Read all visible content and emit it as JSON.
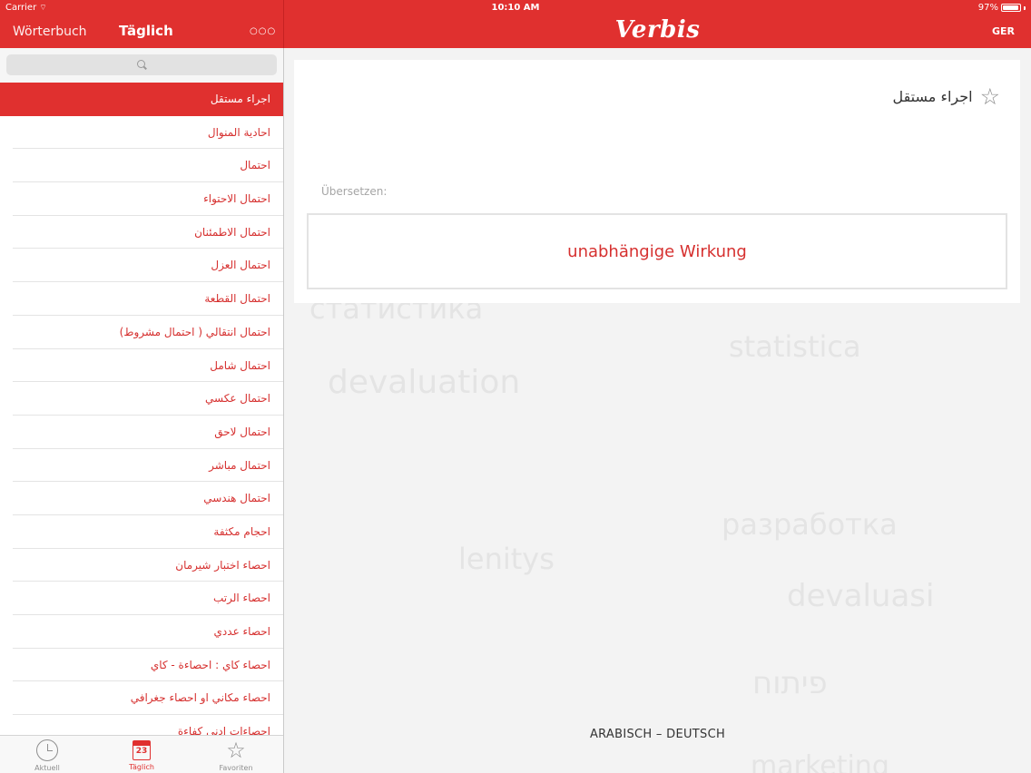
{
  "status_bar": {
    "carrier": "Carrier",
    "time": "10:10 AM",
    "battery": "97%",
    "battery_level": 0.97
  },
  "sidebar_nav": {
    "back_label": "Wörterbuch",
    "title": "Täglich",
    "more_label": "○○○"
  },
  "main_nav": {
    "logo": "Verbis",
    "language_button": "GER"
  },
  "search": {
    "placeholder": ""
  },
  "word_list": [
    {
      "text": "اجراء مستقل",
      "active": true
    },
    {
      "text": "احادية المنوال"
    },
    {
      "text": "احتمال"
    },
    {
      "text": "احتمال الاحتواء"
    },
    {
      "text": "احتمال الاطمئنان"
    },
    {
      "text": "احتمال العزل"
    },
    {
      "text": "احتمال القطعة"
    },
    {
      "text": "احتمال انتقالي ( احتمال مشروط)"
    },
    {
      "text": "احتمال شامل"
    },
    {
      "text": "احتمال عكسي"
    },
    {
      "text": "احتمال لاحق"
    },
    {
      "text": "احتمال مباشر"
    },
    {
      "text": "احتمال هندسي"
    },
    {
      "text": "احجام مكثفة"
    },
    {
      "text": "احصاء اختبار شيرمان"
    },
    {
      "text": "احصاء الرتب"
    },
    {
      "text": "احصاء عددي"
    },
    {
      "text": "احصاء كاي : احصاءة - كاي"
    },
    {
      "text": "احصاء مكاني او احصاء جغرافي"
    },
    {
      "text": "احصاءات ادنى كفاءة"
    }
  ],
  "tabbar": {
    "tabs": [
      {
        "label": "Aktuell",
        "icon": "clock-icon"
      },
      {
        "label": "Täglich",
        "icon": "calendar-icon",
        "badge": "23",
        "active": true
      },
      {
        "label": "Favoriten",
        "icon": "star-icon"
      }
    ]
  },
  "entry": {
    "word": "اجراء مستقل",
    "favorite_icon": "star-outline-icon",
    "translate_label": "Übersetzen:",
    "translation": "unabhängige Wirkung"
  },
  "background_words": [
    {
      "text": "статистика"
    },
    {
      "text": "statistica"
    },
    {
      "text": "devaluation"
    },
    {
      "text": "разработка"
    },
    {
      "text": "lenitys"
    },
    {
      "text": "devaluasi"
    },
    {
      "text": "פיתוח"
    },
    {
      "text": "marketing"
    }
  ],
  "footer": {
    "language_pair": "ARABISCH – DEUTSCH"
  },
  "colors": {
    "accent": "#e0302f",
    "accent_text": "#d6302f"
  }
}
